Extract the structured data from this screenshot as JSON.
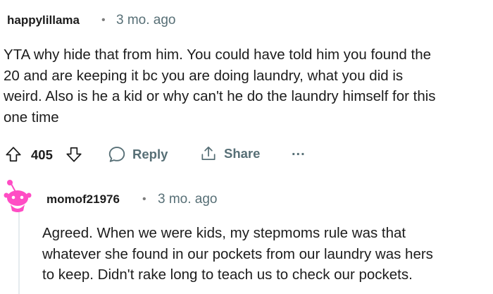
{
  "comments": [
    {
      "username": "happylillama",
      "separator": "•",
      "time": "3 mo. ago",
      "lines": [
        "YTA why hide that from him. You could have told him you found the",
        "20 and are keeping it bc you are doing laundry, what you did is",
        "weird. Also is he a kid or why can't he do the laundry himself for this",
        "one time"
      ],
      "score": "405",
      "reply_label": "Reply",
      "share_label": "Share",
      "more_label": "..."
    },
    {
      "username": "momof21976",
      "separator": "•",
      "time": "3 mo. ago",
      "avatar_color": "#ff4dc4",
      "lines": [
        "Agreed. When we were kids, my stepmoms rule was that",
        "whatever she found in our pockets from our laundry was hers",
        "to keep. Didn't rake long to teach us to check our pockets."
      ]
    }
  ],
  "colors": {
    "text": "#1c1c1c",
    "meta": "#576f76",
    "thread_line": "#e5ebee",
    "avatar_pink": "#ff4dc4"
  },
  "icons": {
    "upvote": "arrow-up-outline-icon",
    "downvote": "arrow-down-outline-icon",
    "reply": "speech-bubble-icon",
    "share": "share-upload-icon",
    "more": "ellipsis-icon"
  }
}
